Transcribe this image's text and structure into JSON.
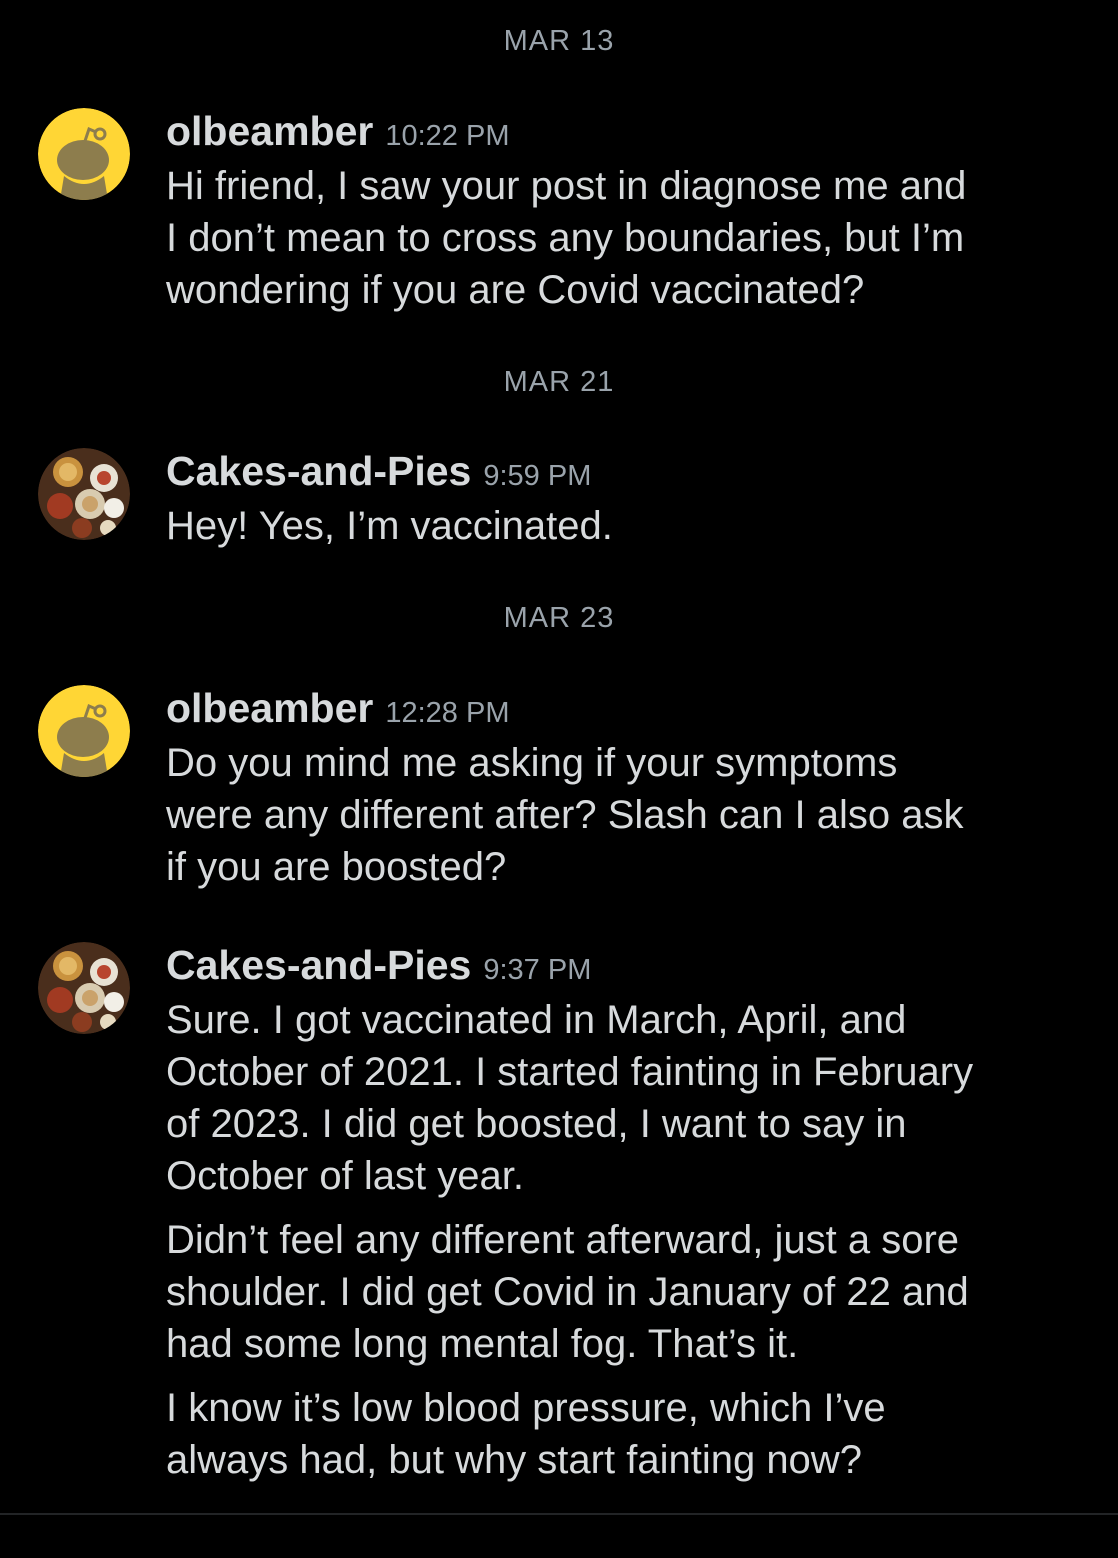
{
  "thread": {
    "dates": [
      "MAR 13",
      "MAR 21",
      "MAR 23"
    ],
    "messages": [
      {
        "username": "olbeamber",
        "time": "10:22 PM",
        "avatar_icon": "reddit-snoo-avatar-icon",
        "paragraphs": [
          "Hi friend, I saw your post in diagnose me  and\nI don’t mean to cross any boundaries, but I’m\nwondering if you are Covid vaccinated?"
        ]
      },
      {
        "username": "Cakes-and-Pies",
        "time": "9:59 PM",
        "avatar_icon": "food-photo-avatar-icon",
        "paragraphs": [
          "Hey! Yes, I’m vaccinated."
        ]
      },
      {
        "username": "olbeamber",
        "time": "12:28 PM",
        "avatar_icon": "reddit-snoo-avatar-icon",
        "paragraphs": [
          "Do you mind me asking if your symptoms\nwere any different after? Slash can I also ask\nif you are boosted?"
        ]
      },
      {
        "username": "Cakes-and-Pies",
        "time": "9:37 PM",
        "avatar_icon": "food-photo-avatar-icon",
        "paragraphs": [
          "Sure. I got vaccinated in March, April, and\nOctober of 2021. I started fainting in February\nof 2023. I did get boosted, I want to say in\nOctober of last year.",
          "Didn’t feel any different afterward, just a sore\nshoulder. I did get Covid in January of 22 and\nhad some long mental fog. That’s it.",
          "I know it’s low blood pressure, which I’ve\nalways had, but why start fainting now?"
        ]
      }
    ]
  },
  "colors": {
    "background": "#000000",
    "text_primary": "#d7dadc",
    "text_secondary": "#9aa3ab",
    "snoo_avatar_bg": "#ffd635"
  }
}
